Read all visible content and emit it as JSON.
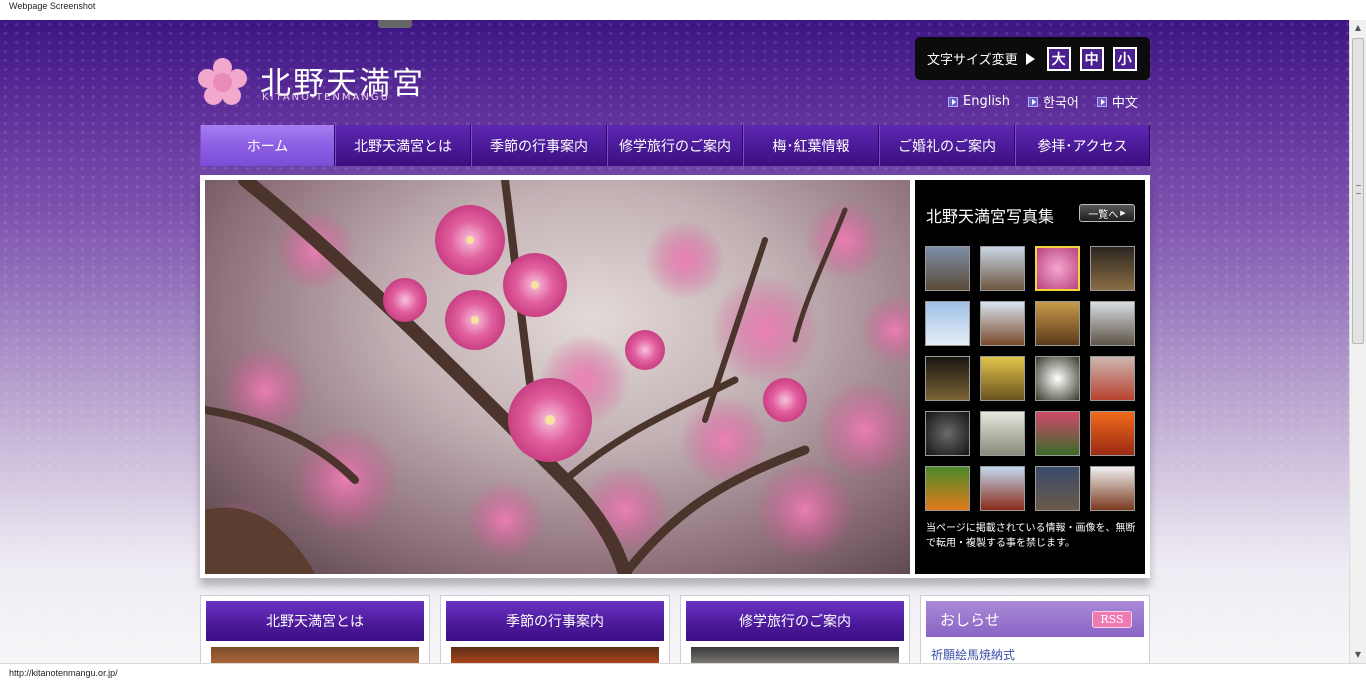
{
  "browser": {
    "title": "Webpage Screenshot",
    "status_url": "http://kitanotenmangu.or.jp/"
  },
  "header": {
    "logo_jp": "北野天満宮",
    "logo_en": "KITANO-TENMANGU",
    "textsize": {
      "label": "文字サイズ変更",
      "large": "大",
      "medium": "中",
      "small": "小"
    },
    "languages": [
      "English",
      "한국어",
      "中文"
    ]
  },
  "nav": [
    "ホーム",
    "北野天満宮とは",
    "季節の行事案内",
    "修学旅行のご案内",
    "梅･紅葉情報",
    "ご婚礼のご案内",
    "参拝･アクセス"
  ],
  "gallery": {
    "title": "北野天満宮写真集",
    "more_label": "一覧へ",
    "note": "当ページに掲載されている情報・画像を、無断で転用・複製する事を禁じます。",
    "selected_index": 2
  },
  "cards": [
    "北野天満宮とは",
    "季節の行事案内",
    "修学旅行のご案内"
  ],
  "news": {
    "title": "おしらせ",
    "rss_label": "RSS",
    "first_item": "祈願絵馬焼納式"
  },
  "colors": {
    "nav_purple": "#4a1a98",
    "nav_active": "#8c5fe4",
    "plum_pink": "#f2a8cc",
    "thumb_selected": "#f2d33a",
    "rss_pink": "#f07ab2"
  }
}
